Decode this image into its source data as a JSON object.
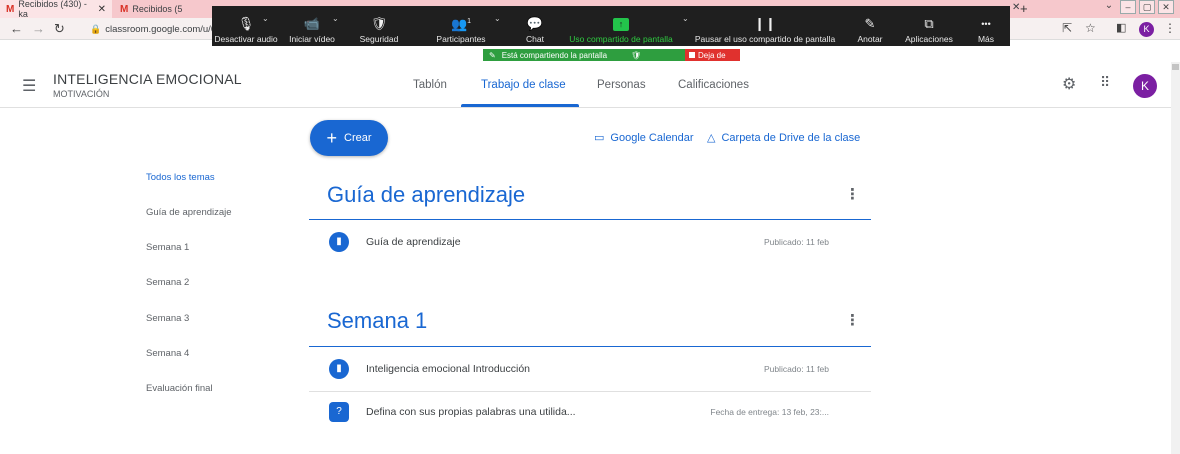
{
  "browser": {
    "tabs": [
      {
        "label": "Recibidos (430) - ka",
        "active": true
      },
      {
        "label": "Recibidos (5",
        "active": false
      }
    ],
    "url": "classroom.google.com/u/0/w/ND YxMjIzNzkxMDk1/t/all",
    "avatar": "K"
  },
  "zoom": {
    "items": [
      {
        "key": "mute",
        "label": "Desactivar audio",
        "icon": "🎙"
      },
      {
        "key": "video",
        "label": "Iniciar vídeo",
        "icon": "📹"
      },
      {
        "key": "security",
        "label": "Seguridad",
        "icon": "🛡"
      },
      {
        "key": "participants",
        "label": "Participantes",
        "icon": "👥",
        "count": "1"
      },
      {
        "key": "chat",
        "label": "Chat",
        "icon": "💬"
      },
      {
        "key": "share",
        "label": "Uso compartido de pantalla",
        "icon": "↑"
      },
      {
        "key": "pause",
        "label": "Pausar el uso compartido de pantalla",
        "icon": "❙❙"
      },
      {
        "key": "annotate",
        "label": "Anotar",
        "icon": "✎"
      },
      {
        "key": "apps",
        "label": "Aplicaciones",
        "icon": "⧉"
      },
      {
        "key": "more",
        "label": "Más",
        "icon": "•••"
      }
    ],
    "sharing_banner": "Está compartiendo la pantalla",
    "stop_label": "Deja de"
  },
  "header": {
    "title": "INTELIGENCIA EMOCIONAL",
    "subtitle": "MOTIVACIÓN",
    "tabs": [
      "Tablón",
      "Trabajo de clase",
      "Personas",
      "Calificaciones"
    ],
    "active_tab": "Trabajo de clase",
    "avatar": "K"
  },
  "toolbar": {
    "create_label": "Crear",
    "calendar_label": "Google Calendar",
    "drive_label": "Carpeta de Drive de la clase"
  },
  "topics": [
    "Todos los temas",
    "Guía de aprendizaje",
    "Semana 1",
    "Semana 2",
    "Semana 3",
    "Semana 4",
    "Evaluación final"
  ],
  "sections": [
    {
      "title": "Guía de aprendizaje",
      "items": [
        {
          "title": "Guía de aprendizaje",
          "date": "Publicado: 11 feb",
          "icon": "material-icon"
        }
      ]
    },
    {
      "title": "Semana 1",
      "items": [
        {
          "title": "Inteligencia emocional Introducción",
          "date": "Publicado: 11 feb",
          "icon": "material-icon"
        },
        {
          "title": "Defina con sus propias palabras una utilida...",
          "date": "Fecha de entrega: 13 feb, 23:...",
          "icon": "question-icon"
        }
      ]
    }
  ],
  "colors": {
    "accent": "#1967d2",
    "avatar": "#7b1fa2",
    "zoom_green": "#2e9e3f",
    "zoom_stop": "#e0312e"
  }
}
